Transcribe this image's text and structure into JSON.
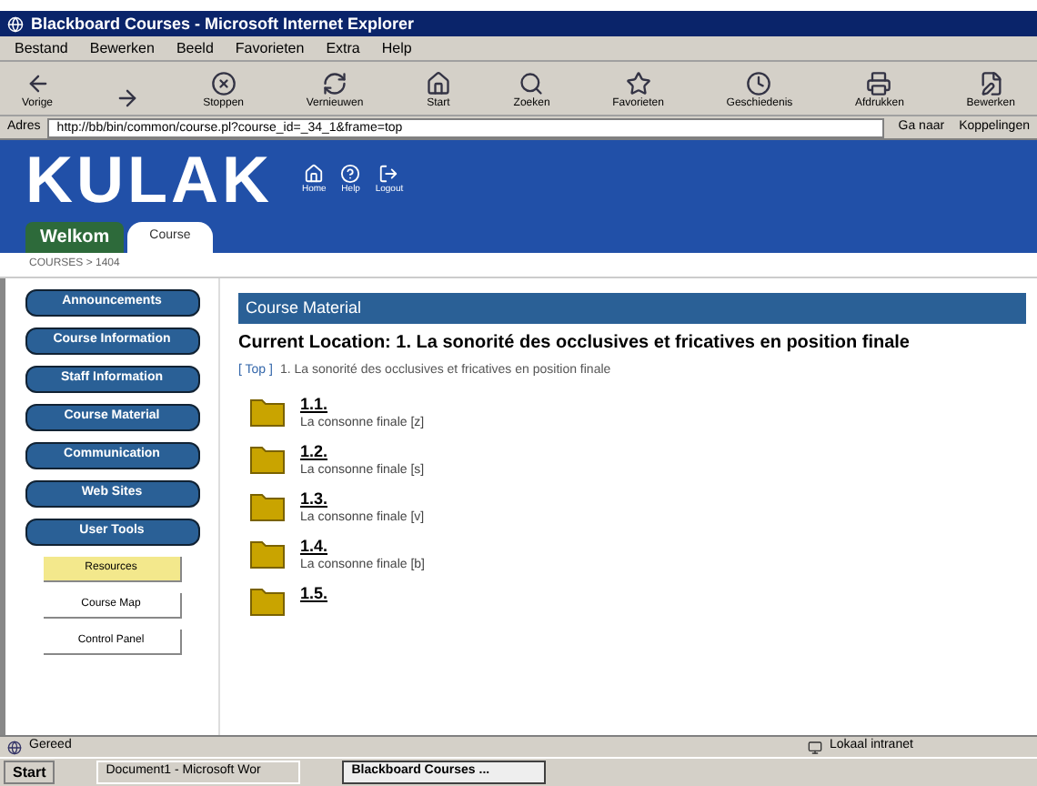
{
  "window": {
    "title": "Blackboard Courses - Microsoft Internet Explorer"
  },
  "menu": [
    "Bestand",
    "Bewerken",
    "Beeld",
    "Favorieten",
    "Extra",
    "Help"
  ],
  "toolbar": [
    {
      "kind": "back",
      "label": "Vorige"
    },
    {
      "kind": "forward"
    },
    {
      "kind": "stop",
      "label": "Stoppen"
    },
    {
      "kind": "refresh",
      "label": "Vernieuwen"
    },
    {
      "kind": "home",
      "label": "Start"
    },
    {
      "kind": "search",
      "label": "Zoeken"
    },
    {
      "kind": "favorites",
      "label": "Favorieten"
    },
    {
      "kind": "history",
      "label": "Geschiedenis"
    },
    {
      "kind": "print",
      "label": "Afdrukken"
    },
    {
      "kind": "edit",
      "label": "Bewerken"
    }
  ],
  "address": {
    "label": "Adres",
    "value": "http://bb/bin/common/course.pl?course_id=_34_1&frame=top",
    "go": "Ga naar",
    "links": "Koppelingen"
  },
  "header": {
    "logo": "KULAK",
    "icons": [
      {
        "kind": "home",
        "label": "Home"
      },
      {
        "kind": "help",
        "label": "Help"
      },
      {
        "kind": "logout",
        "label": "Logout"
      }
    ],
    "tabs": [
      {
        "label": "Welkom",
        "selected": false
      },
      {
        "label": "Course",
        "selected": true
      }
    ]
  },
  "breadcrumb": "COURSES > 1404",
  "sidebar": [
    {
      "label": "Announcements",
      "kind": "main",
      "selected": false
    },
    {
      "label": "Course Information",
      "kind": "main",
      "selected": false
    },
    {
      "label": "Staff Information",
      "kind": "main",
      "selected": false
    },
    {
      "label": "Course Material",
      "kind": "main",
      "selected": false
    },
    {
      "label": "Communication",
      "kind": "main",
      "selected": false
    },
    {
      "label": "Web Sites",
      "kind": "main",
      "selected": false
    },
    {
      "label": "User Tools",
      "kind": "main",
      "selected": false
    },
    {
      "label": "Resources",
      "kind": "sub",
      "selected": true
    },
    {
      "label": "Course Map",
      "kind": "sub",
      "selected": false
    },
    {
      "label": "Control Panel",
      "kind": "sub",
      "selected": false
    }
  ],
  "content": {
    "heading": "Course Material",
    "location": "Current Location: 1. La sonorité des occlusives et fricatives en position finale",
    "top_link": "[ Top ]",
    "path": "1. La sonorité des occlusives et fricatives en position finale",
    "items": [
      {
        "title": "1.1.",
        "description": "La consonne finale [z]"
      },
      {
        "title": "1.2.",
        "description": "La consonne finale [s]"
      },
      {
        "title": "1.3.",
        "description": "La consonne finale [v]"
      },
      {
        "title": "1.4.",
        "description": "La consonne finale [b]"
      },
      {
        "title": "1.5."
      }
    ]
  },
  "status_bar": {
    "text": "Gereed",
    "zone": "Lokaal intranet"
  },
  "taskbar": {
    "start": "Start",
    "tasks": [
      {
        "label": "Document1 - Microsoft Wor",
        "selected": false
      },
      {
        "label": "Blackboard Courses ...",
        "selected": true
      }
    ]
  }
}
